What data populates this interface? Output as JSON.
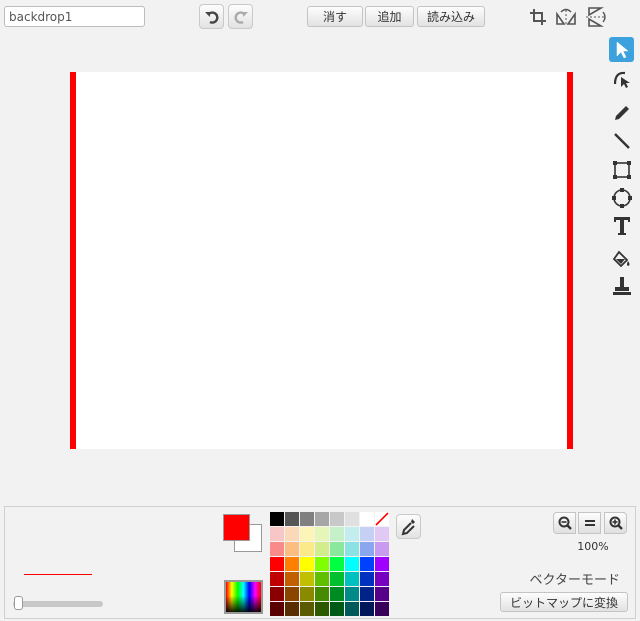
{
  "costume": {
    "name_value": "backdrop1"
  },
  "toolbar": {
    "clear_label": "消す",
    "add_label": "追加",
    "import_label": "読み込み",
    "undo_icon": "undo-icon",
    "redo_icon": "redo-icon"
  },
  "top_tools": [
    "crop-icon",
    "flip-horizontal-icon",
    "flip-vertical-icon"
  ],
  "tools": [
    "select-icon",
    "reshape-icon",
    "pencil-icon",
    "line-icon",
    "rectangle-icon",
    "ellipse-icon",
    "text-icon",
    "fill-icon",
    "stamp-icon"
  ],
  "colors": {
    "primary": "#ff0000",
    "secondary": "#ffffff",
    "palette": [
      "#000000",
      "#555555",
      "#808080",
      "#a6a6a6",
      "#c8c8c8",
      "#e0e0e0",
      "#ffffff",
      "none",
      "#f7c6c6",
      "#fbd8b8",
      "#fdf4b8",
      "#e5f6b8",
      "#c6f1c8",
      "#c2eeef",
      "#c6d0f5",
      "#e1c8f5",
      "#f88a8a",
      "#fbbd80",
      "#fbe98a",
      "#d2ee8a",
      "#8ae89c",
      "#8ae2e5",
      "#8aa6ef",
      "#c89af0",
      "#ff0000",
      "#ff8000",
      "#ffff00",
      "#80ff00",
      "#00ff40",
      "#00ffff",
      "#0040ff",
      "#a000ff",
      "#c00000",
      "#c06000",
      "#c0c000",
      "#60c000",
      "#00c030",
      "#00c0c0",
      "#0030c0",
      "#7800c0",
      "#8a0000",
      "#8a4500",
      "#8a8a00",
      "#458a00",
      "#008a23",
      "#008a8a",
      "#00238a",
      "#56008a",
      "#5a0000",
      "#5a2d00",
      "#5a5a00",
      "#2d5a00",
      "#005a17",
      "#005a5a",
      "#00175a",
      "#38005a"
    ]
  },
  "zoom": {
    "level": "100%"
  },
  "mode": {
    "label": "ベクターモード",
    "convert_label": "ビットマップに変換"
  },
  "stroke": {
    "width_fraction": 0.02
  }
}
